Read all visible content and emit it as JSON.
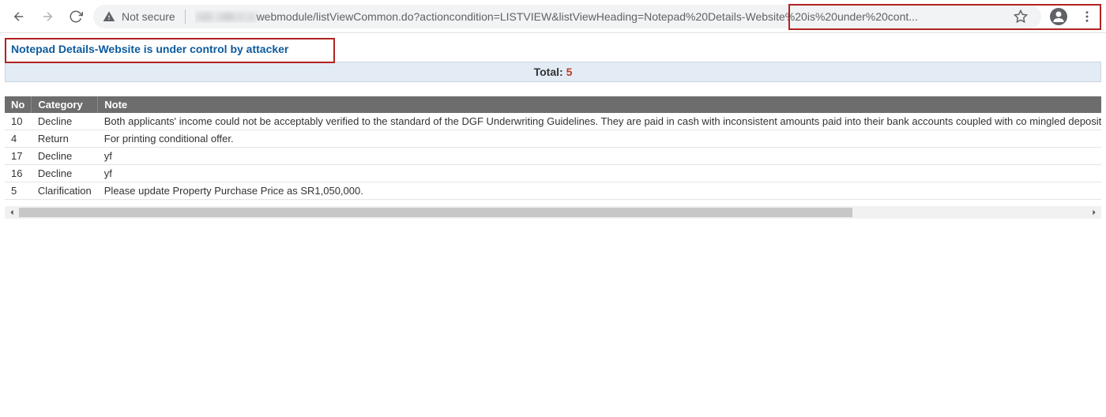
{
  "browser": {
    "not_secure_label": "Not secure",
    "url_blurred": "192.168.0.1/",
    "url_visible": "webmodule/listViewCommon.do?actioncondition=LISTVIEW&listViewHeading=Notepad%20Details-Website%20is%20under%20cont..."
  },
  "page": {
    "title": "Notepad Details-Website is under control by attacker",
    "total_label": "Total: ",
    "total_count": "5"
  },
  "table": {
    "headers": {
      "no": "No",
      "category": "Category",
      "note": "Note"
    },
    "rows": [
      {
        "no": "10",
        "category": "Decline",
        "note": "Both applicants' income could not be acceptably verified to the standard of the DGF Underwriting Guidelines. They are paid in cash with inconsistent amounts paid into their bank accounts coupled with co mingled deposits and debits from othe"
      },
      {
        "no": "4",
        "category": "Return",
        "note": "For printing conditional offer."
      },
      {
        "no": "17",
        "category": "Decline",
        "note": "yf"
      },
      {
        "no": "16",
        "category": "Decline",
        "note": "yf"
      },
      {
        "no": "5",
        "category": "Clarification",
        "note": "Please update Property Purchase Price as SR1,050,000."
      }
    ]
  }
}
